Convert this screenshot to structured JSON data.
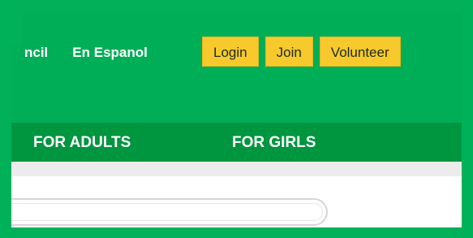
{
  "top_links": [
    "ncil",
    "En Espanol"
  ],
  "buttons": {
    "login": "Login",
    "join": "Join",
    "volunteer": "Volunteer"
  },
  "nav": {
    "for_adults": "FOR ADULTS",
    "for_girls": "FOR GIRLS"
  },
  "colors": {
    "brand_green": "#00ae58",
    "nav_green": "#00953f",
    "button_yellow": "#f7c92d"
  }
}
